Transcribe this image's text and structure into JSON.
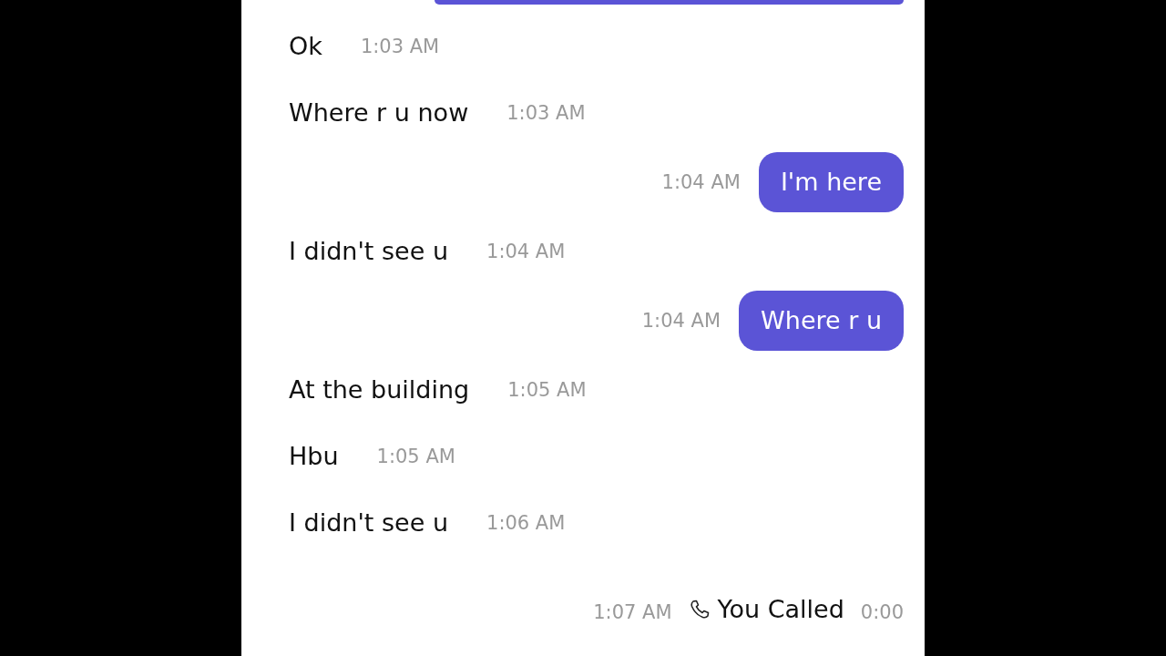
{
  "messages": [
    {
      "kind": "cut_bubble"
    },
    {
      "kind": "received",
      "text": "Ok",
      "time": "1:03 AM"
    },
    {
      "kind": "received",
      "text": "Where r u now",
      "time": "1:03 AM"
    },
    {
      "kind": "sent",
      "text": "I'm here",
      "time": "1:04 AM"
    },
    {
      "kind": "received",
      "text": "I didn't see u",
      "time": "1:04 AM"
    },
    {
      "kind": "sent",
      "text": "Where r u",
      "time": "1:04 AM"
    },
    {
      "kind": "received",
      "text": "At the building",
      "time": "1:05 AM"
    },
    {
      "kind": "received",
      "text": "Hbu",
      "time": "1:05 AM"
    },
    {
      "kind": "received",
      "text": "I didn't see u",
      "time": "1:06 AM"
    },
    {
      "kind": "call",
      "text": "You Called",
      "time": "1:07 AM",
      "duration": "0:00"
    }
  ]
}
